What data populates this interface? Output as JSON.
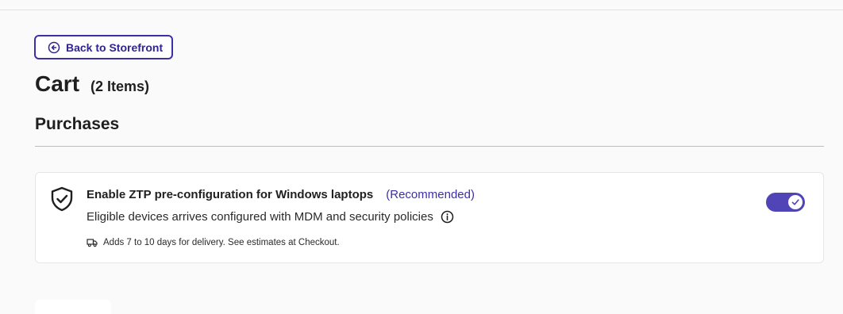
{
  "back_button": {
    "label": "Back to Storefront",
    "icon": "arrow-left-circle-icon"
  },
  "cart": {
    "title": "Cart",
    "count": "(2 Items)"
  },
  "purchases": {
    "heading": "Purchases"
  },
  "ztp_card": {
    "title": "Enable ZTP pre-configuration for Windows laptops",
    "recommended": "(Recommended)",
    "description": "Eligible devices arrives configured with MDM and security policies",
    "delivery_note": "Adds 7 to 10 days for delivery. See estimates at Checkout.",
    "toggle_on": true,
    "icons": {
      "shield": "shield-check-icon",
      "info": "info-icon",
      "truck": "truck-icon",
      "check": "check-icon"
    }
  },
  "colors": {
    "accent": "#3d2fa8",
    "toggle": "#5044b6"
  }
}
